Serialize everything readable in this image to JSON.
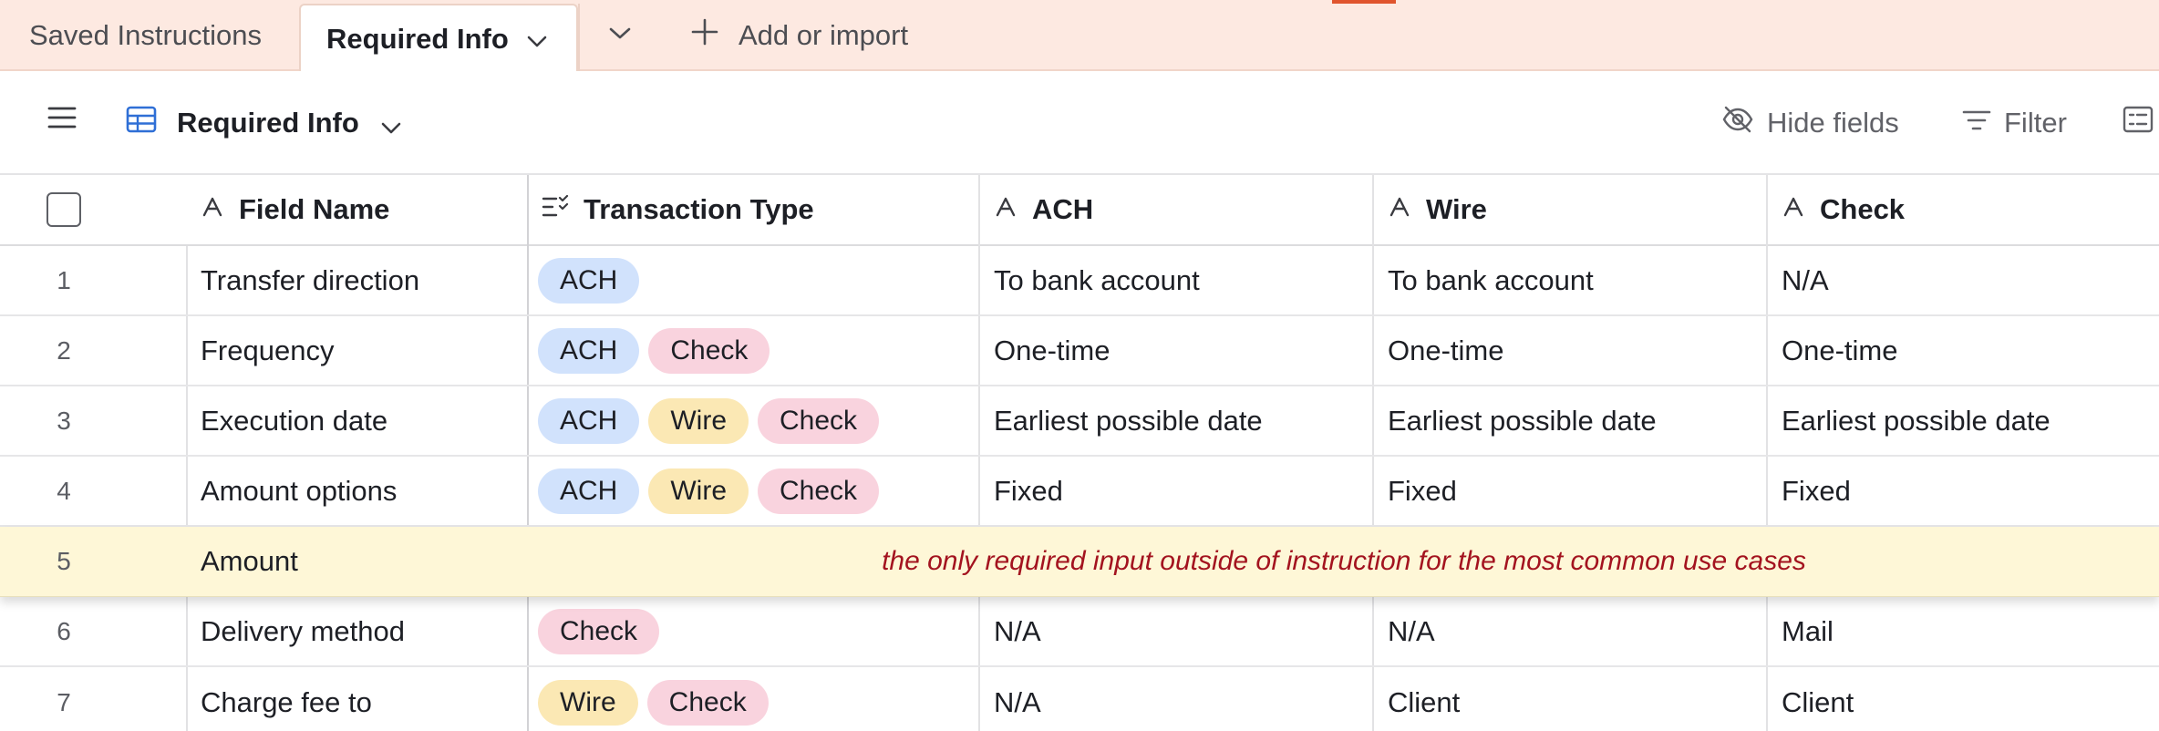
{
  "tabs": {
    "saved": "Saved Instructions",
    "active": "Required Info",
    "add_import": "Add or import"
  },
  "toolbar": {
    "view_name": "Required Info",
    "hide_fields": "Hide fields",
    "filter": "Filter"
  },
  "columns": {
    "field_name": "Field Name",
    "transaction_type": "Transaction Type",
    "ach": "ACH",
    "wire": "Wire",
    "check": "Check"
  },
  "rows": [
    {
      "num": "1",
      "name": "Transfer direction",
      "types": [
        "ACH"
      ],
      "ach": "To bank account",
      "wire": "To bank account",
      "check": "N/A"
    },
    {
      "num": "2",
      "name": "Frequency",
      "types": [
        "ACH",
        "Check"
      ],
      "ach": "One-time",
      "wire": "One-time",
      "check": "One-time"
    },
    {
      "num": "3",
      "name": "Execution date",
      "types": [
        "ACH",
        "Wire",
        "Check"
      ],
      "ach": "Earliest possible date",
      "wire": "Earliest possible date",
      "check": "Earliest possible date"
    },
    {
      "num": "4",
      "name": "Amount options",
      "types": [
        "ACH",
        "Wire",
        "Check"
      ],
      "ach": "Fixed",
      "wire": "Fixed",
      "check": "Fixed"
    },
    {
      "num": "5",
      "name": "Amount",
      "annotation": "the only required input outside of instruction for the most common use cases"
    },
    {
      "num": "6",
      "name": "Delivery method",
      "types": [
        "Check"
      ],
      "ach": "N/A",
      "wire": "N/A",
      "check": "Mail"
    },
    {
      "num": "7",
      "name": "Charge fee to",
      "types": [
        "Wire",
        "Check"
      ],
      "ach": "N/A",
      "wire": "Client",
      "check": "Client"
    }
  ],
  "colors": {
    "tabbar_bg": "#fde9e1",
    "accent": "#e0542d",
    "pill_ach": "#d1e2fc",
    "pill_wire": "#fbe8b4",
    "pill_check": "#f9d3de",
    "highlight_row": "#fef7d7",
    "annotation_text": "#a3131f"
  },
  "icons": [
    "chevron-down-icon",
    "plus-icon",
    "menu-icon",
    "grid-view-icon",
    "eye-off-icon",
    "filter-icon",
    "row-height-icon",
    "text-field-icon",
    "multi-select-icon"
  ]
}
